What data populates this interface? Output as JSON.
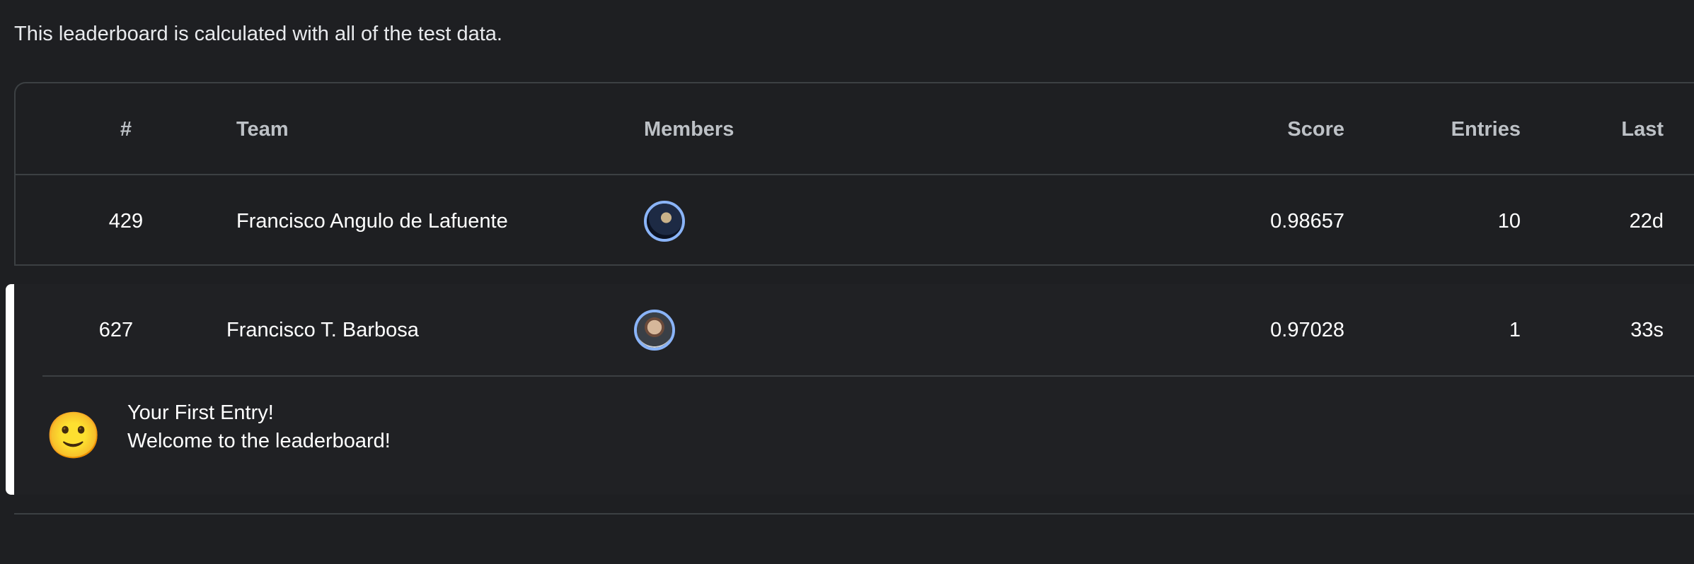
{
  "intro_text": "This leaderboard is calculated with all of the test data.",
  "columns": {
    "rank": "#",
    "team": "Team",
    "members": "Members",
    "score": "Score",
    "entries": "Entries",
    "last": "Last"
  },
  "rows": [
    {
      "rank": "429",
      "team": "Francisco Angulo de Lafuente",
      "members": [
        "avatar"
      ],
      "score": "0.98657",
      "entries": "10",
      "last": "22d"
    }
  ],
  "my_entry": {
    "rank": "627",
    "team": "Francisco T. Barbosa",
    "members": [
      "avatar"
    ],
    "score": "0.97028",
    "entries": "1",
    "last": "33s",
    "emoji": "🙂",
    "message_title": "Your First Entry!",
    "message_subtitle": "Welcome to the leaderboard!"
  },
  "colors": {
    "background": "#1e1f22",
    "highlight_bar": "#ffffff",
    "avatar_ring": "#8ab4f8",
    "divider": "#3c4043"
  }
}
